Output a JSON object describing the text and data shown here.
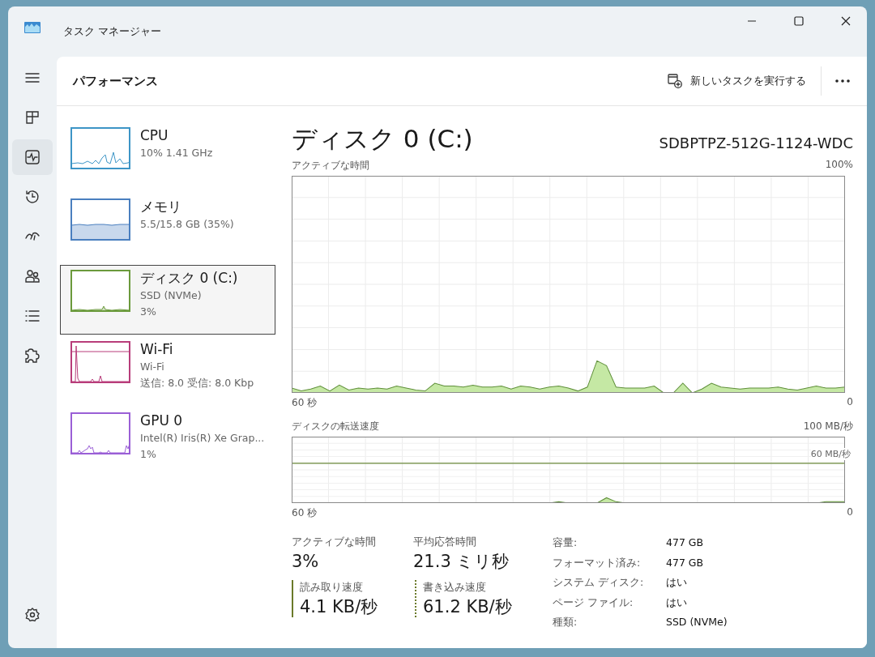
{
  "window": {
    "title": "タスク マネージャー"
  },
  "nav": [
    {
      "kind": "menu",
      "selected": false
    },
    {
      "kind": "processes",
      "selected": false
    },
    {
      "kind": "performance",
      "selected": true
    },
    {
      "kind": "history",
      "selected": false
    },
    {
      "kind": "startup",
      "selected": false
    },
    {
      "kind": "users",
      "selected": false
    },
    {
      "kind": "details",
      "selected": false
    },
    {
      "kind": "services",
      "selected": false
    }
  ],
  "header": {
    "title": "パフォーマンス",
    "run_task": "新しいタスクを実行する"
  },
  "devices": [
    {
      "kind": "cpu",
      "name": "CPU",
      "lines": [
        "10%  1.41 GHz"
      ],
      "color": "#3d95c6",
      "selected": false
    },
    {
      "kind": "memory",
      "name": "メモリ",
      "lines": [
        "5.5/15.8 GB (35%)"
      ],
      "color": "#4a7fbf",
      "selected": false
    },
    {
      "kind": "disk",
      "name": "ディスク 0 (C:)",
      "lines": [
        "SSD (NVMe)",
        "3%"
      ],
      "color": "#6b9a3c",
      "selected": true
    },
    {
      "kind": "network",
      "name": "Wi-Fi",
      "lines": [
        "Wi-Fi",
        "送信: 8.0  受信: 8.0 Kbp"
      ],
      "color": "#b83d7a",
      "selected": false
    },
    {
      "kind": "gpu",
      "name": "GPU 0",
      "lines": [
        "Intel(R) Iris(R) Xe Grap...",
        "1%"
      ],
      "color": "#9a5fd6",
      "selected": false
    }
  ],
  "detail": {
    "title": "ディスク 0 (C:)",
    "model": "SDBPTPZ-512G-1124-WDC",
    "active_chart": {
      "label": "アクティブな時間",
      "max": "100%",
      "x_start": "60 秒",
      "x_end": "0"
    },
    "transfer_chart": {
      "label": "ディスクの転送速度",
      "max": "100 MB/秒",
      "line_label": "60 MB/秒",
      "x_start": "60 秒",
      "x_end": "0"
    },
    "stats": [
      {
        "label": "アクティブな時間",
        "value": "3%"
      },
      {
        "label": "平均応答時間",
        "value": "21.3 ミリ秒"
      }
    ],
    "rates": [
      {
        "kind": "read",
        "label": "読み取り速度",
        "value": "4.1 KB/秒"
      },
      {
        "kind": "write",
        "label": "書き込み速度",
        "value": "61.2 KB/秒"
      }
    ],
    "properties": [
      {
        "label": "容量:",
        "value": "477 GB"
      },
      {
        "label": "フォーマット済み:",
        "value": "477 GB"
      },
      {
        "label": "システム ディスク:",
        "value": "はい"
      },
      {
        "label": "ページ ファイル:",
        "value": "はい"
      },
      {
        "label": "種類:",
        "value": "SSD (NVMe)"
      }
    ]
  }
}
